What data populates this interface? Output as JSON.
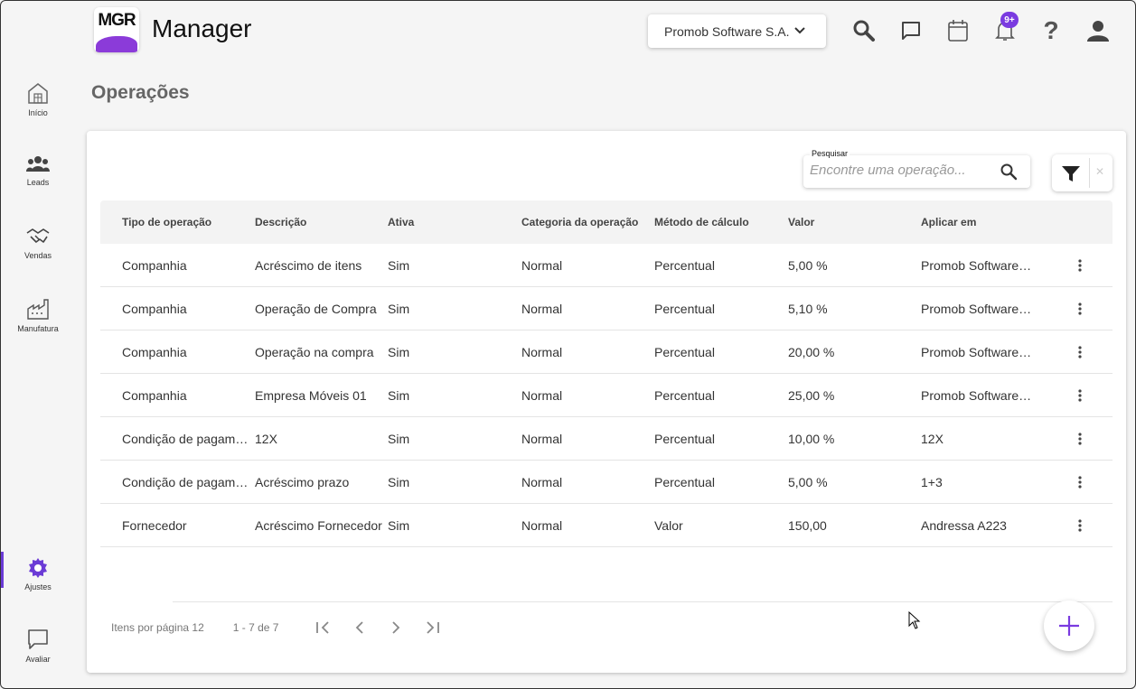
{
  "header": {
    "logo_text": "MGR",
    "app_title": "Manager",
    "company": "Promob Software S.A.",
    "notification_badge": "9+",
    "help_glyph": "?",
    "icons": [
      "search-icon",
      "chat-icon",
      "calendar-icon",
      "bell-icon",
      "help-icon",
      "user-icon"
    ]
  },
  "sidebar": {
    "items": [
      {
        "label": "Início",
        "icon": "home-icon"
      },
      {
        "label": "Leads",
        "icon": "people-icon"
      },
      {
        "label": "Vendas",
        "icon": "handshake-icon"
      },
      {
        "label": "Manufatura",
        "icon": "factory-icon"
      },
      {
        "label": "Ajustes",
        "icon": "gear-icon",
        "active": true
      },
      {
        "label": "Avaliar",
        "icon": "feedback-icon"
      }
    ]
  },
  "page": {
    "title": "Operações"
  },
  "search": {
    "label": "Pesquisar",
    "placeholder": "Encontre uma operação..."
  },
  "table": {
    "columns": [
      "Tipo de operação",
      "Descrição",
      "Ativa",
      "Categoria da operação",
      "Método de cálculo",
      "Valor",
      "Aplicar em"
    ],
    "rows": [
      [
        "Companhia",
        "Acréscimo de itens",
        "Sim",
        "Normal",
        "Percentual",
        "5,00 %",
        "Promob Software S.A."
      ],
      [
        "Companhia",
        "Operação de Compra",
        "Sim",
        "Normal",
        "Percentual",
        "5,10 %",
        "Promob Software S.A."
      ],
      [
        "Companhia",
        "Operação na compra",
        "Sim",
        "Normal",
        "Percentual",
        "20,00 %",
        "Promob Software S.A."
      ],
      [
        "Companhia",
        "Empresa Móveis 01",
        "Sim",
        "Normal",
        "Percentual",
        "25,00 %",
        "Promob Software S.A."
      ],
      [
        "Condição de pagamento",
        "12X",
        "Sim",
        "Normal",
        "Percentual",
        "10,00 %",
        "12X"
      ],
      [
        "Condição de pagamento",
        "Acréscimo prazo",
        "Sim",
        "Normal",
        "Percentual",
        "5,00 %",
        "1+3"
      ],
      [
        "Fornecedor",
        "Acréscimo Fornecedor",
        "Sim",
        "Normal",
        "Valor",
        "150,00",
        "Andressa A223"
      ]
    ]
  },
  "pagination": {
    "items_per_page": "Itens por página 12",
    "range": "1 - 7 de 7"
  },
  "colors": {
    "accent": "#7a3be0",
    "logo_purple": "#8b3bd9"
  }
}
